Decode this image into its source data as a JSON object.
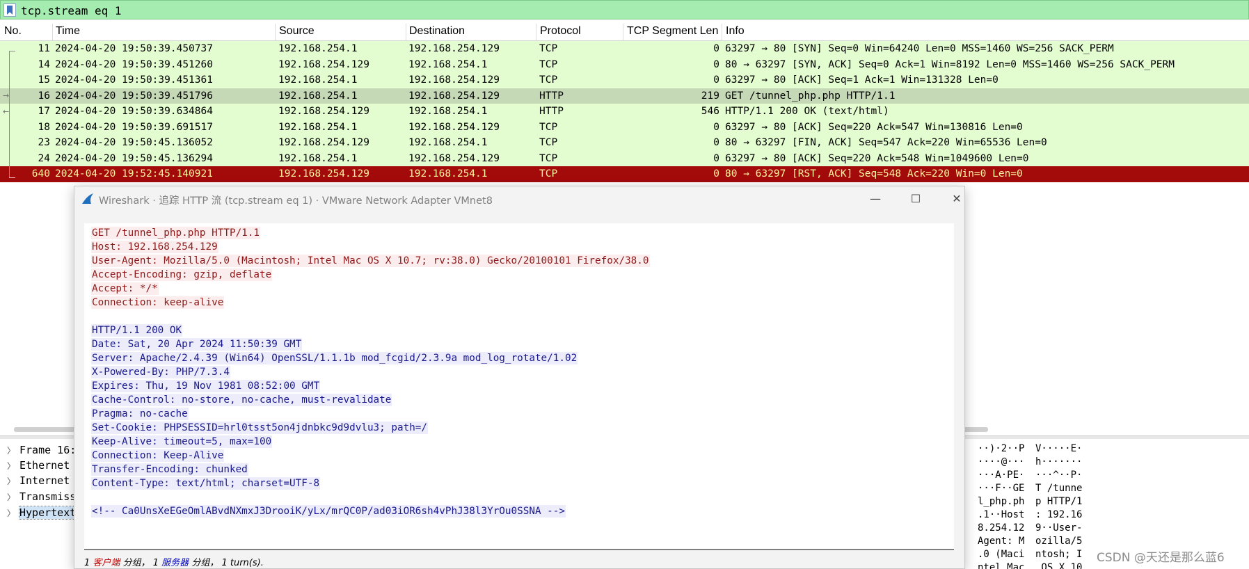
{
  "filter": {
    "text": "tcp.stream eq 1"
  },
  "columns": [
    "No.",
    "Time",
    "Source",
    "Destination",
    "Protocol",
    "TCP Segment Len",
    "Info"
  ],
  "packets": [
    {
      "no": "11",
      "time": "2024-04-20 19:50:39.450737",
      "src": "192.168.254.1",
      "dst": "192.168.254.129",
      "proto": "TCP",
      "len": "0",
      "info": "63297 → 80 [SYN] Seq=0 Win=64240 Len=0 MSS=1460 WS=256 SACK_PERM"
    },
    {
      "no": "14",
      "time": "2024-04-20 19:50:39.451260",
      "src": "192.168.254.129",
      "dst": "192.168.254.1",
      "proto": "TCP",
      "len": "0",
      "info": "80 → 63297 [SYN, ACK] Seq=0 Ack=1 Win=8192 Len=0 MSS=1460 WS=256 SACK_PERM"
    },
    {
      "no": "15",
      "time": "2024-04-20 19:50:39.451361",
      "src": "192.168.254.1",
      "dst": "192.168.254.129",
      "proto": "TCP",
      "len": "0",
      "info": "63297 → 80 [ACK] Seq=1 Ack=1 Win=131328 Len=0"
    },
    {
      "no": "16",
      "time": "2024-04-20 19:50:39.451796",
      "src": "192.168.254.1",
      "dst": "192.168.254.129",
      "proto": "HTTP",
      "len": "219",
      "info": "GET /tunnel_php.php HTTP/1.1"
    },
    {
      "no": "17",
      "time": "2024-04-20 19:50:39.634864",
      "src": "192.168.254.129",
      "dst": "192.168.254.1",
      "proto": "HTTP",
      "len": "546",
      "info": "HTTP/1.1 200 OK  (text/html)"
    },
    {
      "no": "18",
      "time": "2024-04-20 19:50:39.691517",
      "src": "192.168.254.1",
      "dst": "192.168.254.129",
      "proto": "TCP",
      "len": "0",
      "info": "63297 → 80 [ACK] Seq=220 Ack=547 Win=130816 Len=0"
    },
    {
      "no": "23",
      "time": "2024-04-20 19:50:45.136052",
      "src": "192.168.254.129",
      "dst": "192.168.254.1",
      "proto": "TCP",
      "len": "0",
      "info": "80 → 63297 [FIN, ACK] Seq=547 Ack=220 Win=65536 Len=0"
    },
    {
      "no": "24",
      "time": "2024-04-20 19:50:45.136294",
      "src": "192.168.254.1",
      "dst": "192.168.254.129",
      "proto": "TCP",
      "len": "0",
      "info": "63297 → 80 [ACK] Seq=220 Ack=548 Win=1049600 Len=0"
    },
    {
      "no": "640",
      "time": "2024-04-20 19:52:45.140921",
      "src": "192.168.254.129",
      "dst": "192.168.254.1",
      "proto": "TCP",
      "len": "0",
      "info": "80 → 63297 [RST, ACK] Seq=548 Ack=220 Win=0 Len=0"
    }
  ],
  "details": [
    "Frame 16:",
    "Ethernet",
    "Internet",
    "Transmiss",
    "Hypertext"
  ],
  "bytes": [
    [
      "··)·2··P",
      "V·····E·"
    ],
    [
      "····@···",
      "h·······"
    ],
    [
      "···A·PE·",
      "···^··P·"
    ],
    [
      "···F··GE",
      "T /tunne"
    ],
    [
      "l_php.ph",
      "p HTTP/1"
    ],
    [
      ".1··Host",
      ": 192.16"
    ],
    [
      "8.254.12",
      "9··User-"
    ],
    [
      "Agent: M",
      "ozilla/5"
    ],
    [
      ".0 (Maci",
      "ntosh; I"
    ],
    [
      "ntel Mac",
      " OS X 10"
    ]
  ],
  "dialog": {
    "title": "Wireshark · 追踪 HTTP 流 (tcp.stream eq 1) · VMware Network Adapter VMnet8",
    "minimize": "—",
    "maximize": "☐",
    "close": "✕",
    "client_lines": [
      "GET /tunnel_php.php HTTP/1.1",
      "Host: 192.168.254.129",
      "User-Agent: Mozilla/5.0 (Macintosh; Intel Mac OS X 10.7; rv:38.0) Gecko/20100101 Firefox/38.0",
      "Accept-Encoding: gzip, deflate",
      "Accept: */*",
      "Connection: keep-alive"
    ],
    "server_lines": [
      "HTTP/1.1 200 OK",
      "Date: Sat, 20 Apr 2024 11:50:39 GMT",
      "Server: Apache/2.4.39 (Win64) OpenSSL/1.1.1b mod_fcgid/2.3.9a mod_log_rotate/1.02",
      "X-Powered-By: PHP/7.3.4",
      "Expires: Thu, 19 Nov 1981 08:52:00 GMT",
      "Cache-Control: no-store, no-cache, must-revalidate",
      "Pragma: no-cache",
      "Set-Cookie: PHPSESSID=hrl0tsst5on4jdnbkc9d9dvlu3; path=/",
      "Keep-Alive: timeout=5, max=100",
      "Connection: Keep-Alive",
      "Transfer-Encoding: chunked",
      "Content-Type: text/html; charset=UTF-8"
    ],
    "body_line": "<!-- Ca0UnsXeEGeOmlABvdNXmxJ3DrooiK/yLx/mrQC0P/ad03iOR6sh4vPhJ38l3YrOu0SSNA -->",
    "status": {
      "client_count": "1",
      "client_label": "客户端",
      "mid1": "分组，",
      "server_count": "1",
      "server_label": "服务器",
      "mid2": "分组，",
      "turns": "1 turn(s)."
    }
  },
  "watermark": "CSDN @天还是那么蓝6"
}
